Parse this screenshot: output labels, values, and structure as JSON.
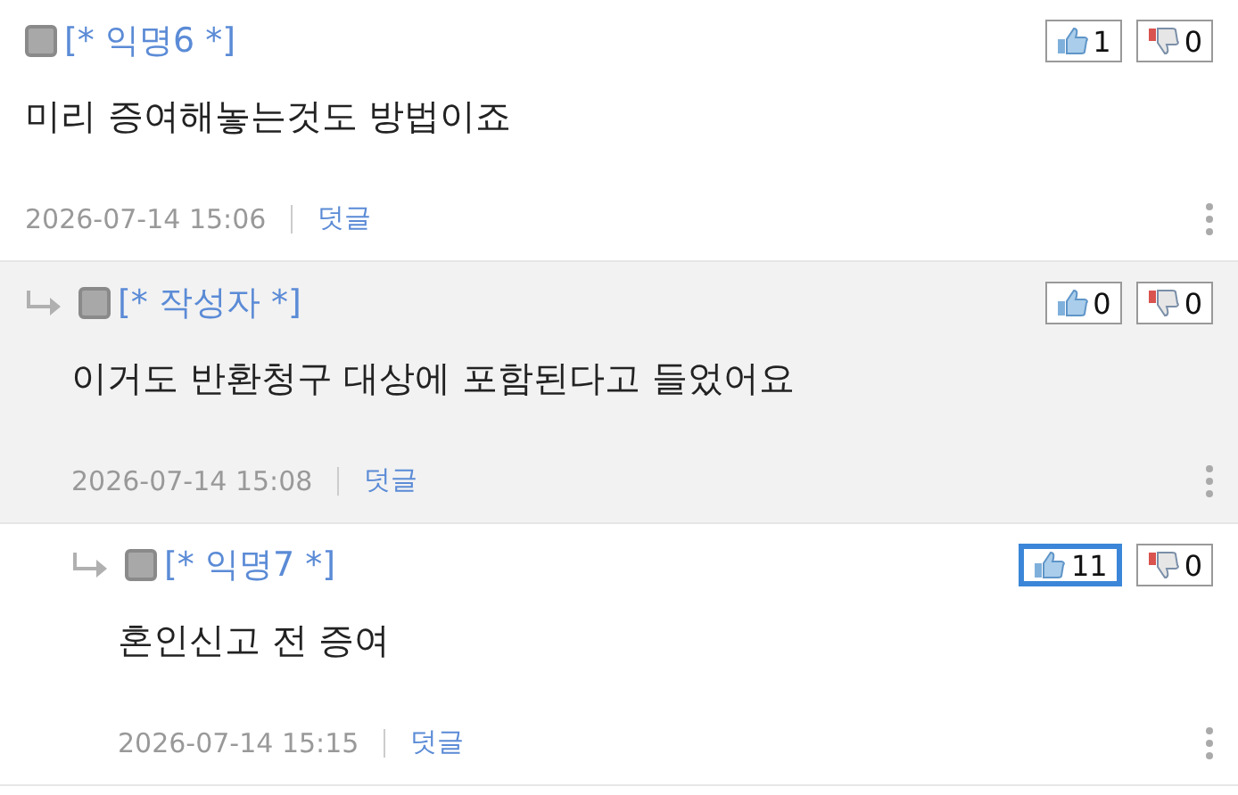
{
  "comments": [
    {
      "author": "[* 익명6 *]",
      "text": "미리 증여해놓는것도 방법이죠",
      "date": "2026-07-14 15:06",
      "reply_label": "덧글",
      "likes": "1",
      "dislikes": "0",
      "like_selected": false,
      "shaded": false,
      "children": [
        {
          "author": "[* 작성자 *]",
          "text": "이거도 반환청구 대상에 포함된다고 들었어요",
          "date": "2026-07-14 15:08",
          "reply_label": "덧글",
          "likes": "0",
          "dislikes": "0",
          "like_selected": false,
          "shaded": true,
          "children": [
            {
              "author": "[* 익명7 *]",
              "text": "혼인신고 전 증여",
              "date": "2026-07-14 15:15",
              "reply_label": "덧글",
              "likes": "11",
              "dislikes": "0",
              "like_selected": true,
              "shaded": false
            }
          ]
        }
      ]
    }
  ]
}
